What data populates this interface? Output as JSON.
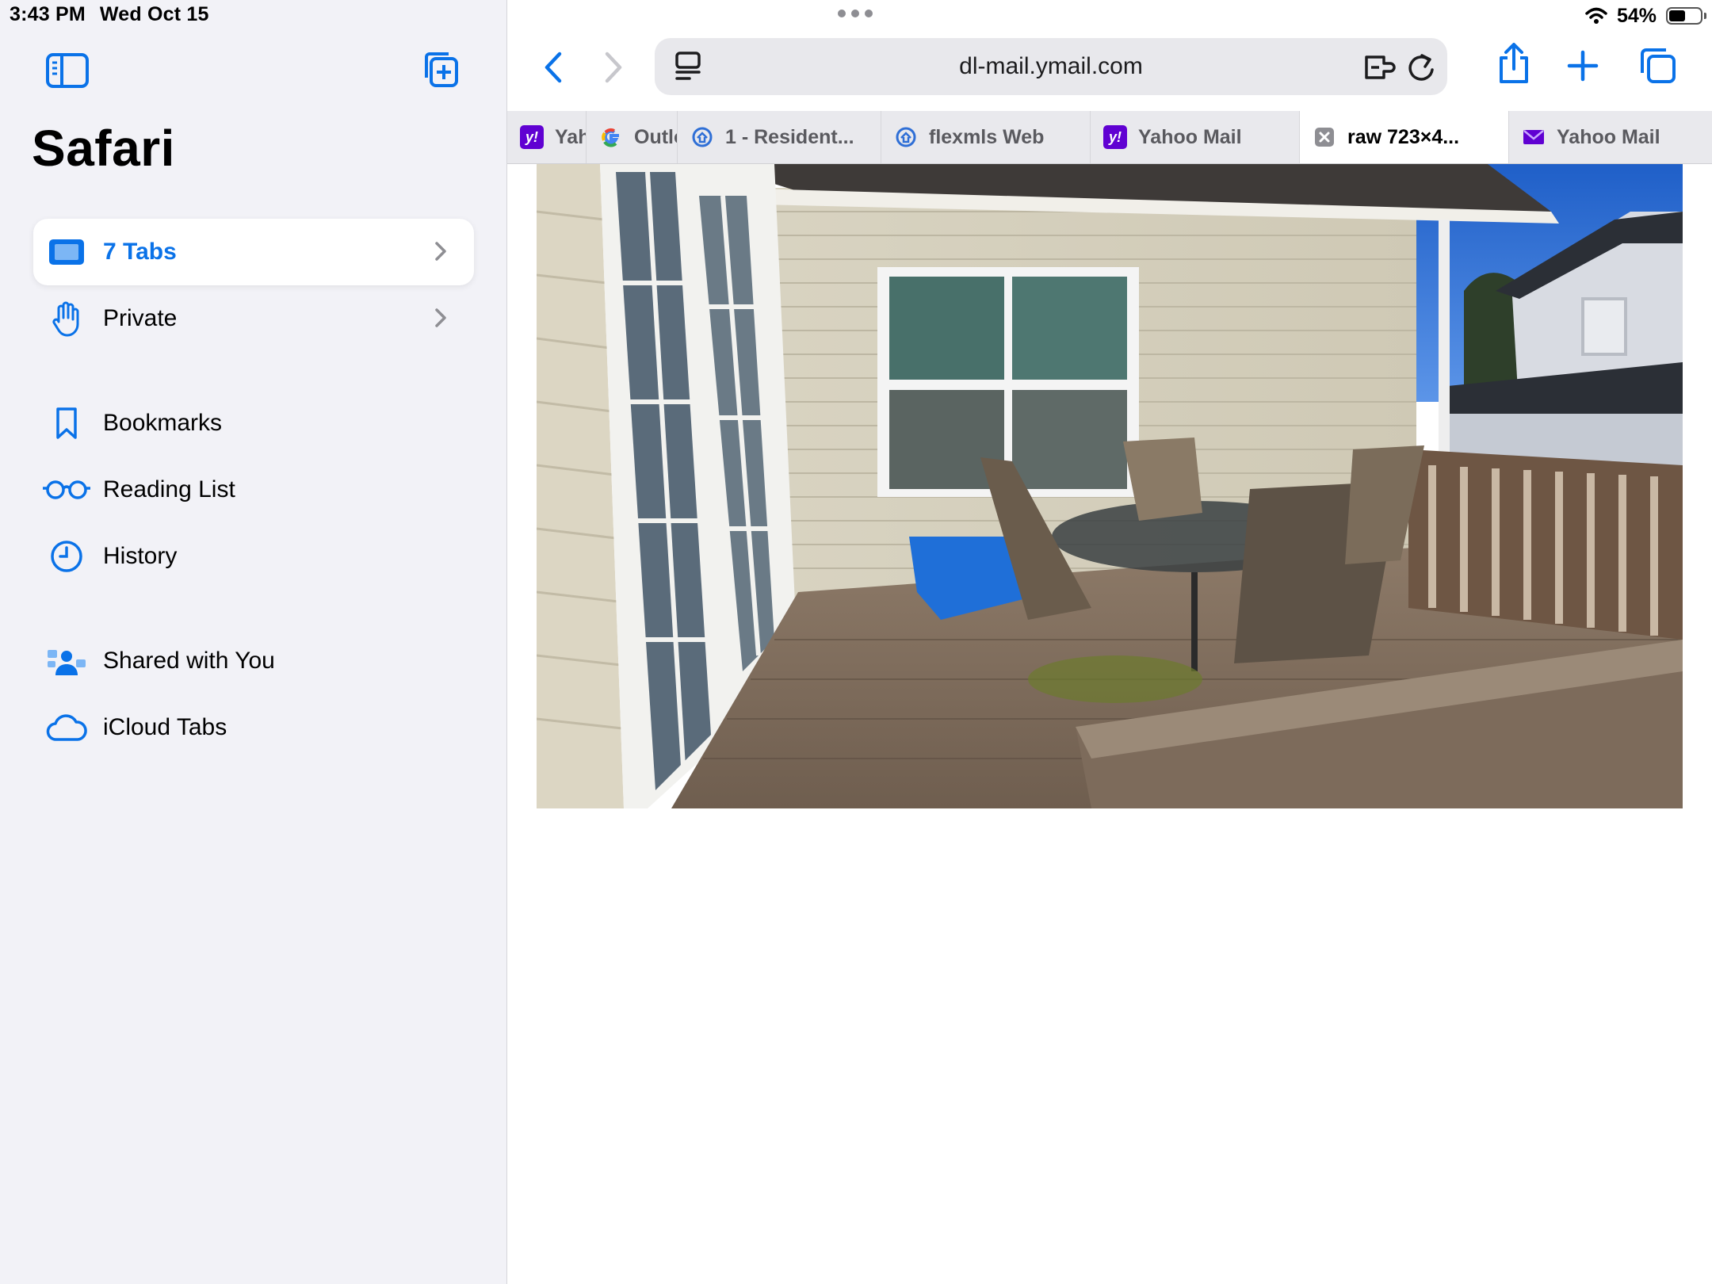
{
  "status": {
    "time": "3:43 PM",
    "date": "Wed Oct 15",
    "battery": "54%",
    "battery_level": 0.54
  },
  "sidebar": {
    "title": "Safari",
    "items": [
      {
        "label": "7 Tabs",
        "icon": "tabs-icon",
        "active": true
      },
      {
        "label": "Private",
        "icon": "hand-icon"
      },
      {
        "label": "Bookmarks",
        "icon": "bookmark-icon"
      },
      {
        "label": "Reading List",
        "icon": "glasses-icon"
      },
      {
        "label": "History",
        "icon": "clock-icon"
      },
      {
        "label": "Shared with You",
        "icon": "shared-people-icon"
      },
      {
        "label": "iCloud Tabs",
        "icon": "cloud-icon"
      }
    ]
  },
  "toolbar": {
    "url": "dl-mail.ymail.com"
  },
  "tabs": [
    {
      "label": "Yahoo Mail",
      "favicon": "yahoo-favicon"
    },
    {
      "label": "Outlook",
      "favicon": "google-favicon"
    },
    {
      "label": "1 - Resident...",
      "favicon": "flexmls-favicon"
    },
    {
      "label": "flexmls Web",
      "favicon": "flexmls-favicon"
    },
    {
      "label": "Yahoo Mail",
      "favicon": "yahoo-favicon"
    },
    {
      "label": "raw 723×4...",
      "favicon": "close-icon",
      "active": true
    },
    {
      "label": "Yahoo Mail",
      "favicon": "mail-favicon"
    }
  ],
  "colors": {
    "accent": "#0a72e8",
    "sidebar_bg": "#f2f2f7",
    "yahoo": "#6001d2"
  }
}
